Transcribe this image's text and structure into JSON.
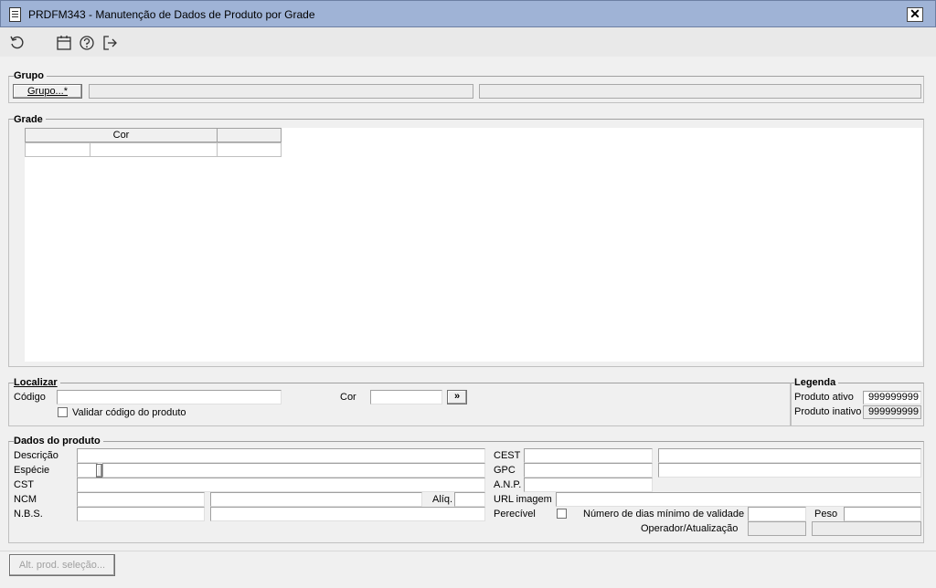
{
  "window": {
    "title": "PRDFM343 - Manutenção de Dados de Produto por Grade",
    "close": "✕"
  },
  "grupo": {
    "legend": "Grupo",
    "button": "Grupo...*"
  },
  "grade": {
    "legend": "Grade",
    "columns": [
      "Cor",
      ""
    ]
  },
  "localizar": {
    "legend": "Localizar",
    "codigo": "Código",
    "cor": "Cor",
    "go": "»",
    "validar": "Validar código do produto"
  },
  "legenda": {
    "legend": "Legenda",
    "ativo": "Produto ativo",
    "ativo_value": "999999999",
    "inativo": "Produto inativo",
    "inativo_value": "999999999"
  },
  "dados": {
    "legend": "Dados do produto",
    "descricao": "Descrição",
    "especie": "Espécie",
    "cst": "CST",
    "ncm": "NCM",
    "nbs": "N.B.S.",
    "aliq": "Alíq.",
    "cest": "CEST",
    "gpc": "GPC",
    "anp": "A.N.P.",
    "url": "URL imagem",
    "perecivel": "Perecível",
    "dias": "Número de dias mínimo de validade",
    "peso": "Peso",
    "operador": "Operador/Atualização"
  },
  "footer": {
    "alt_button": "Alt. prod. seleção..."
  }
}
